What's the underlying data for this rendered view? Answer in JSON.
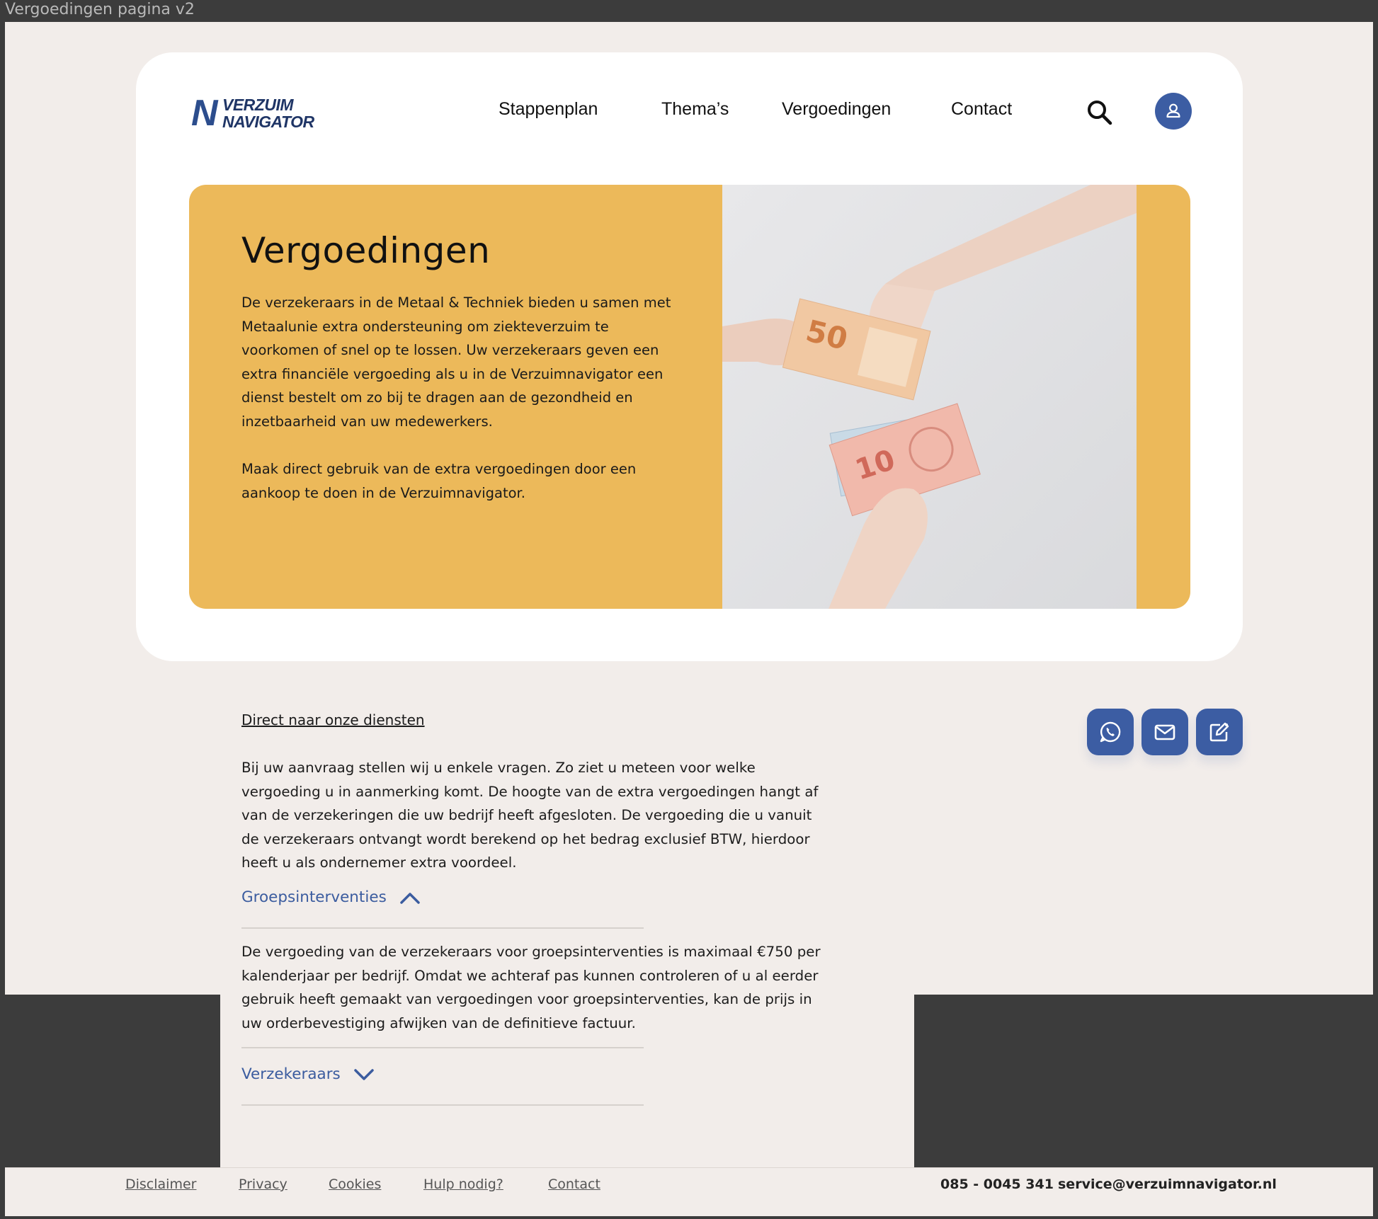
{
  "window": {
    "title": "Vergoedingen pagina v2"
  },
  "logo": {
    "line1": "VERZUIM",
    "line2": "NAVIGATOR",
    "mark": "N"
  },
  "nav": {
    "items": [
      "Stappenplan",
      "Thema’s",
      "Vergoedingen",
      "Contact"
    ],
    "search_icon": "search-icon",
    "account_icon": "user-icon"
  },
  "hero": {
    "title": "Vergoedingen",
    "paragraph1": "De verzekeraars in de Metaal & Techniek bieden u samen met Metaalunie extra ondersteuning om ziekteverzuim te voorkomen of snel op te lossen. Uw verzekeraars geven een extra financiële vergoeding als u in de Verzuimnavigator een dienst bestelt om zo bij te dragen aan de gezondheid en inzetbaarheid van uw medewerkers.",
    "paragraph2": "Maak direct gebruik van de extra vergoedingen door een aankoop te doen in de Verzuimnavigator.",
    "image_alt": "Handen die eurobiljetten van 50 en 10 euro overhandigen"
  },
  "content": {
    "direct_link": "Direct naar onze diensten",
    "intro": "Bij uw aanvraag stellen wij u enkele vragen. Zo ziet u meteen voor welke vergoeding u in aanmerking komt. De hoogte van de extra vergoedingen hangt af van de verzekeringen die uw bedrijf heeft afgesloten. De vergoeding die u vanuit de verzekeraars ontvangt wordt berekend op het bedrag exclusief BTW, hierdoor heeft u als ondernemer extra voordeel."
  },
  "accordion": [
    {
      "title": "Groepsinterventies",
      "expanded": true,
      "body": "De vergoeding van de verzekeraars voor groepsinterventies is maximaal €750 per kalenderjaar per bedrijf.  Omdat we achteraf pas kunnen controleren of u al eerder gebruik heeft gemaakt van vergoedingen voor groepsinterventies, kan de prijs in uw orderbevestiging afwijken van de definitieve factuur."
    },
    {
      "title": "Verzekeraars",
      "expanded": false
    }
  ],
  "contact_buttons": [
    "whatsapp-icon",
    "mail-icon",
    "contact-form-icon"
  ],
  "footer": {
    "links": [
      "Disclaimer",
      "Privacy",
      "Cookies",
      "Hulp nodig?",
      "Contact"
    ],
    "phone": "085 - 0045 341",
    "email": "service@verzuimnavigator.nl"
  },
  "colors": {
    "brand_blue": "#3c5da3",
    "brand_yellow": "#ecb95a",
    "page_bg": "#f2edea"
  }
}
